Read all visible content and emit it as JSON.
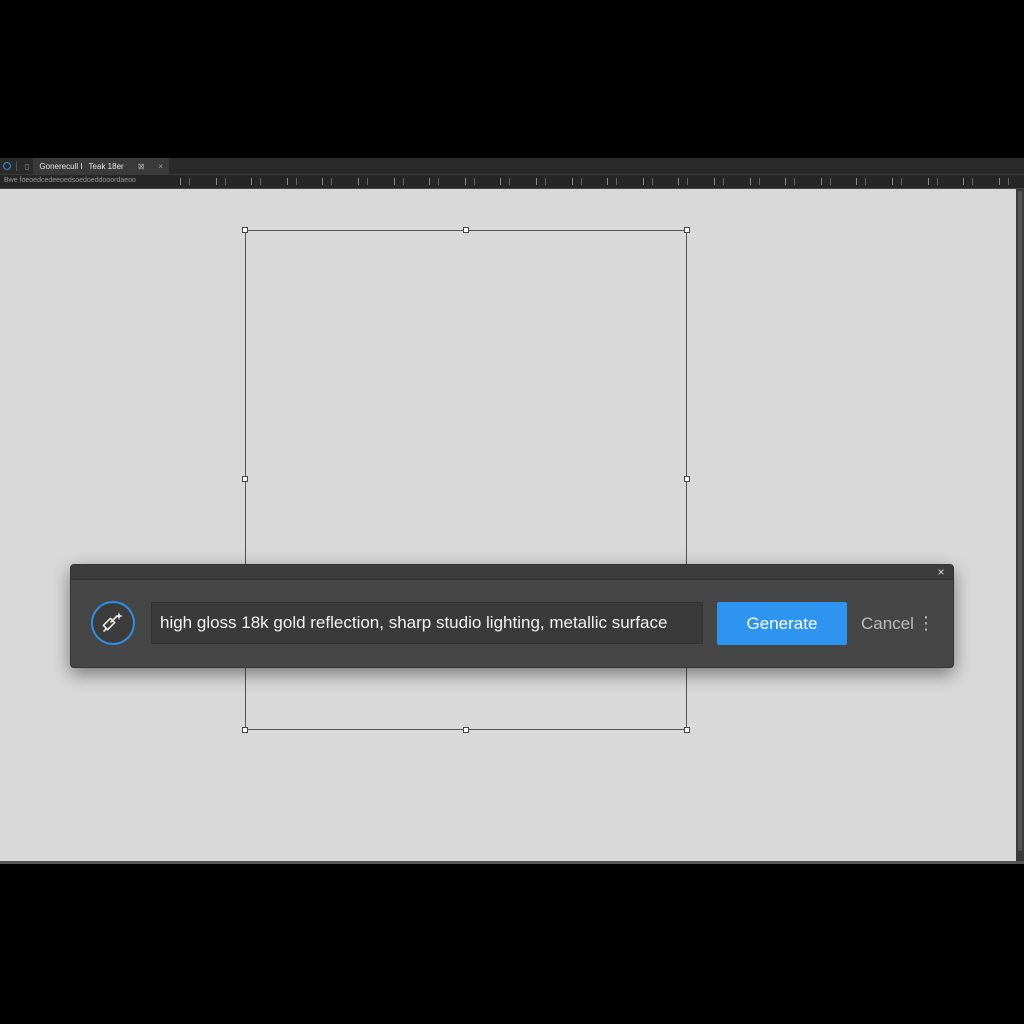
{
  "tabbar": {
    "tab_title": "Gonerecull I",
    "tab_title_2": "Teak 18er",
    "close_glyph": "×",
    "extra_glyph": "⊠"
  },
  "ruler": {
    "path_text": "Bwe foeoedcedeeoedsoedoeddooordaeoo"
  },
  "dialog": {
    "close_label": "×",
    "icon": "magic-wand-sparkle-icon",
    "prompt_value": "high gloss 18k gold reflection, sharp studio lighting, metallic surface",
    "generate_label": "Generate",
    "cancel_label": "Cancel",
    "more_label": "⋮"
  },
  "colors": {
    "accent": "#2d95ef",
    "canvas": "#d9d9d9",
    "panel": "#464646"
  }
}
